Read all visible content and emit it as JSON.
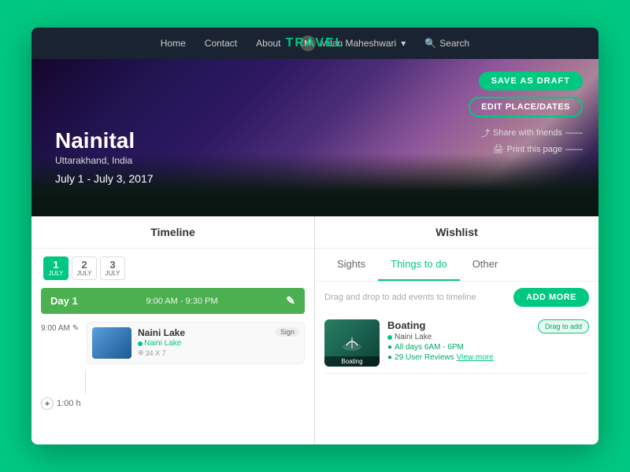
{
  "app": {
    "brand": "TRAVE",
    "brand_highlight": "L",
    "background_color": "#00C880"
  },
  "navbar": {
    "links": [
      "Home",
      "Contact",
      "About"
    ],
    "user": {
      "name": "Milan Maheshwari",
      "avatar_initial": "M"
    },
    "search_label": "Search"
  },
  "hero": {
    "city": "Nainital",
    "region": "Uttarakhand, India",
    "dates": "July 1 - July 3, 2017",
    "save_draft_label": "SAVE AS DRAFT",
    "edit_place_label": "EDIT PLACE/DATES",
    "share_label": "Share with friends",
    "print_label": "Print this page"
  },
  "timeline": {
    "panel_title": "Timeline",
    "day_tabs": [
      {
        "num": "1",
        "month": "JULY",
        "active": true
      },
      {
        "num": "2",
        "month": "JULY",
        "active": false
      },
      {
        "num": "3",
        "month": "JULY",
        "active": false
      }
    ],
    "day_bar": {
      "label": "Day 1",
      "time": "9:00 AM - 9:30 PM",
      "edit_icon": "✎"
    },
    "time_slot": "9:00 AM",
    "activity": {
      "name": "Naini Lake",
      "location": "Naini Lake",
      "coords": "34 X 7",
      "tag": "Sign"
    },
    "duration": "1:00 h"
  },
  "wishlist": {
    "panel_title": "Wishlist",
    "tabs": [
      "Sights",
      "Things to do",
      "Other"
    ],
    "active_tab_index": 1,
    "dnd_hint": "Drag and drop to add events to timeline",
    "add_more_label": "ADD MORE",
    "items": [
      {
        "name": "Boating",
        "location": "Naini Lake",
        "hours": "All days 6AM - 6PM",
        "reviews": "29 User Reviews",
        "view_more": "View more",
        "img_label": "Boating",
        "drag_label": "Drag to add"
      }
    ]
  }
}
